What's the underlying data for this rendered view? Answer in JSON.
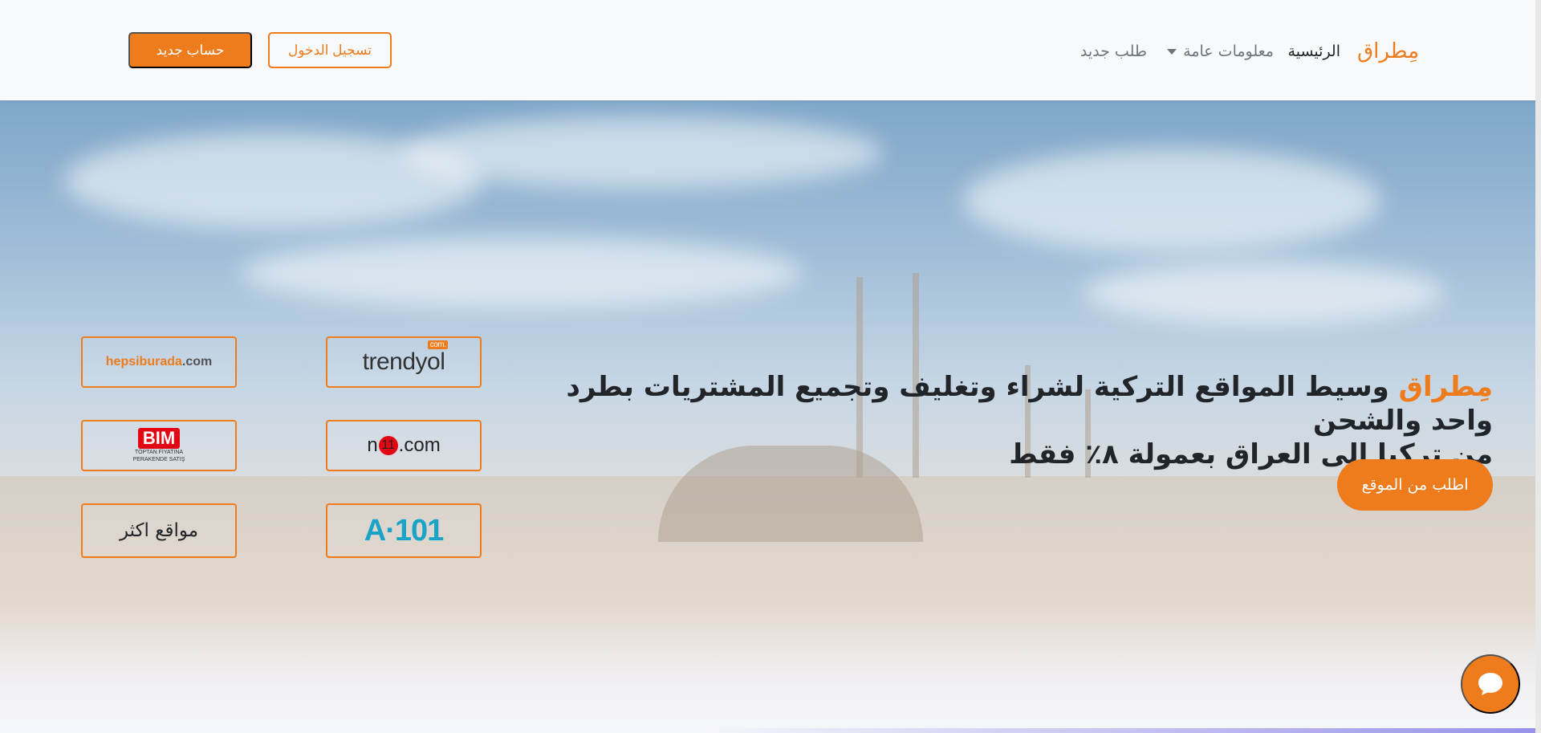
{
  "nav": {
    "brand": "مِطراق",
    "home": "الرئيسية",
    "info": "معلومات عامة",
    "new_order": "طلب جديد",
    "login": "تسجيل الدخول",
    "register": "حساب جديد"
  },
  "hero": {
    "brand": "مِطراق",
    "headline_line1": " وسيط المواقع التركية لشراء وتغليف وتجميع المشتريات بطرد واحد والشحن",
    "headline_line2": "من تركيا الى العراق بعمولة ٨٪ فقط",
    "order_button": "اطلب من الموقع"
  },
  "stores": {
    "hepsiburada": {
      "name": "hepsiburada",
      "suffix": ".com"
    },
    "trendyol": {
      "name": "trendyol",
      "badge": ".com"
    },
    "bim": {
      "name": "BIM",
      "sub1": "TOPTAN FİYATINA",
      "sub2": "PERAKENDE SATIŞ"
    },
    "n11": {
      "pre": "n",
      "mid": "11",
      "suffix": ".com"
    },
    "a101": {
      "name": "A·101"
    },
    "more": "مواقع اكثر"
  },
  "colors": {
    "accent": "#ee7b1c",
    "text": "#212529",
    "muted": "#6c757d"
  }
}
